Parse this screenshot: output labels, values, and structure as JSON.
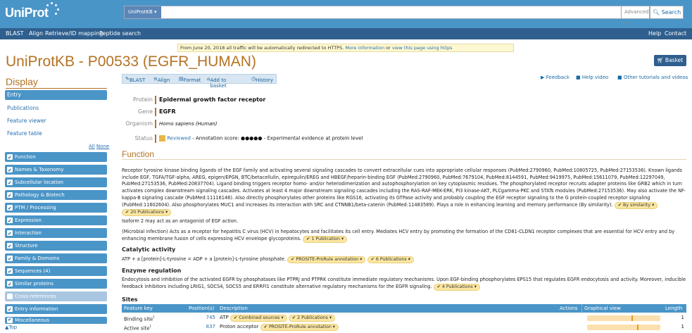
{
  "header": {
    "logo": "UniProt",
    "db_select": "UniProtKB ▾",
    "search_value": "",
    "advanced": "Advanced ▾",
    "search_button": "Search"
  },
  "nav": {
    "items": [
      "BLAST",
      "Align",
      "Retrieve/ID mapping",
      "Peptide search"
    ],
    "right": [
      "Help",
      "Contact"
    ]
  },
  "notice": {
    "text": "From June 20, 2018 all traffic will be automatically redirected to HTTPS.",
    "link1": "More information",
    "or": "or",
    "link2": "view this page using https"
  },
  "title": "UniProtKB - P00533 (EGFR_HUMAN)",
  "basket": "Basket ▾",
  "display": {
    "heading": "Display",
    "entry": "Entry",
    "links": [
      "Publications",
      "Feature viewer",
      "Feature table"
    ],
    "all": "All",
    "none": "None"
  },
  "sections": [
    "Function",
    "Names & Taxonomy",
    "Subcellular location",
    "Pathology & Biotech",
    "PTM / Processing",
    "Expression",
    "Interaction",
    "Structure",
    "Family & Domains",
    "Sequences (4)",
    "Similar proteins",
    "Cross-references",
    "Entry information",
    "Miscellaneous"
  ],
  "to_top": "▲Top",
  "tabs": [
    "BLAST",
    "Align",
    "Format",
    "Add to basket",
    "History"
  ],
  "tab_right": [
    "Feedback",
    "Help video",
    "Other tutorials and videos"
  ],
  "summary": {
    "protein_label": "Protein",
    "protein": "Epidermal growth factor receptor",
    "gene_label": "Gene",
    "gene": "EGFR",
    "organism_label": "Organism",
    "organism": "Homo sapiens (Human)",
    "status_label": "Status",
    "reviewed": "Reviewed",
    "status_text": "- Annotation score: ●●●●● - Experimental evidence at protein level"
  },
  "function": {
    "heading": "Function",
    "p1a": "Receptor tyrosine kinase binding ligands of the EGF family and activating several signaling cascades to convert extracellular cues into appropriate cellular responses (PubMed:2790960, PubMed:10805725, PubMed:27153536). Known ligands include EGF, TGFA/TGF-alpha, AREG, epigen/EPGN, BTC/betacellulin, epiregulin/EREG and HBEGF/heparin-binding EGF (PubMed:2790960, PubMed:7679104, PubMed:8144591, PubMed:9419975, PubMed:15611079, PubMed:12297049, PubMed:27153536, PubMed:20837704). Ligand binding triggers receptor homo- and/or heterodimerization and autophosphorylation on key cytoplasmic residues. The phosphorylated receptor recruits adapter proteins like GRB2 which in turn activates complex downstream signaling cascades. Activates at least 4 major downstream signaling cascades including the RAS-RAF-MEK-ERK, PI3 kinase-AKT, PLCgamma-PKC and STATs modules (PubMed:27153536). May also activate the NF-kappa-B signaling cascade (PubMed:11116146). Also directly phosphorylates other proteins like RGS16, activating its GTPase activity and probably coupling the EGF receptor signaling to the G protein-coupled receptor signaling (PubMed:11602604). Also phosphorylates MUC1 and increases its interaction with SRC and CTNNB1/beta-catenin (PubMed:11483589). Plays a role in enhancing learning and memory performance (By similarity).",
    "p1_pill1": "✔ By similarity ▾",
    "p1_pill2": "✔ 20 Publications ▾",
    "p2": "Isoform 2 may act as an antagonist of EGF action.",
    "p3": "(Microbial infection) Acts as a receptor for hepatitis C virus (HCV) in hepatocytes and facilitates its cell entry. Mediates HCV entry by promoting the formation of the CD81-CLDN1 receptor complexes that are essential for HCV entry and by enhancing membrane fusion of cells expressing HCV envelope glycoproteins.",
    "p3_pill": "✔ 1 Publication ▾",
    "catalytic_h": "Catalytic activity",
    "catalytic": "ATP + a [protein]-L-tyrosine = ADP + a [protein]-L-tyrosine phosphate.",
    "cat_pill1": "✔ PROSITE-ProRule annotation ▾",
    "cat_pill2": "✔ 6 Publications ▾",
    "enzyme_h": "Enzyme regulation",
    "enzyme": "Endocytosis and inhibition of the activated EGFR by phosphatases like PTPRJ and PTPRK constitute immediate regulatory mechanisms. Upon EGF-binding phosphorylates EPS15 that regulates EGFR endocytosis and activity. Moreover, inducible feedback inhibitors including LRIG1, SOCS4, SOCS5 and ERRFI1 constitute alternative regulatory mechanisms for the EGFR signaling.",
    "enz_pill": "✔ 4 Publications ▾"
  },
  "sites": {
    "heading": "Sites",
    "cols": [
      "Feature key",
      "Position(s)",
      "Description",
      "Actions",
      "Graphical view",
      "Length"
    ],
    "rows": [
      {
        "key": "Binding site",
        "pos": "745",
        "desc": "ATP",
        "pill1": "✔ Combined sources ▾",
        "pill2": "✔ 2 Publications ▾",
        "len": "1",
        "frac": 0.62
      },
      {
        "key": "Active site",
        "pos": "837",
        "desc": "Proton acceptor",
        "pill1": "✔ PROSITE-ProRule annotation ▾",
        "pill2": "",
        "len": "1",
        "frac": 0.7
      }
    ]
  },
  "colors": {
    "brand": "#4a95c8",
    "nav": "#2f5f8e",
    "accent": "#b57223"
  }
}
